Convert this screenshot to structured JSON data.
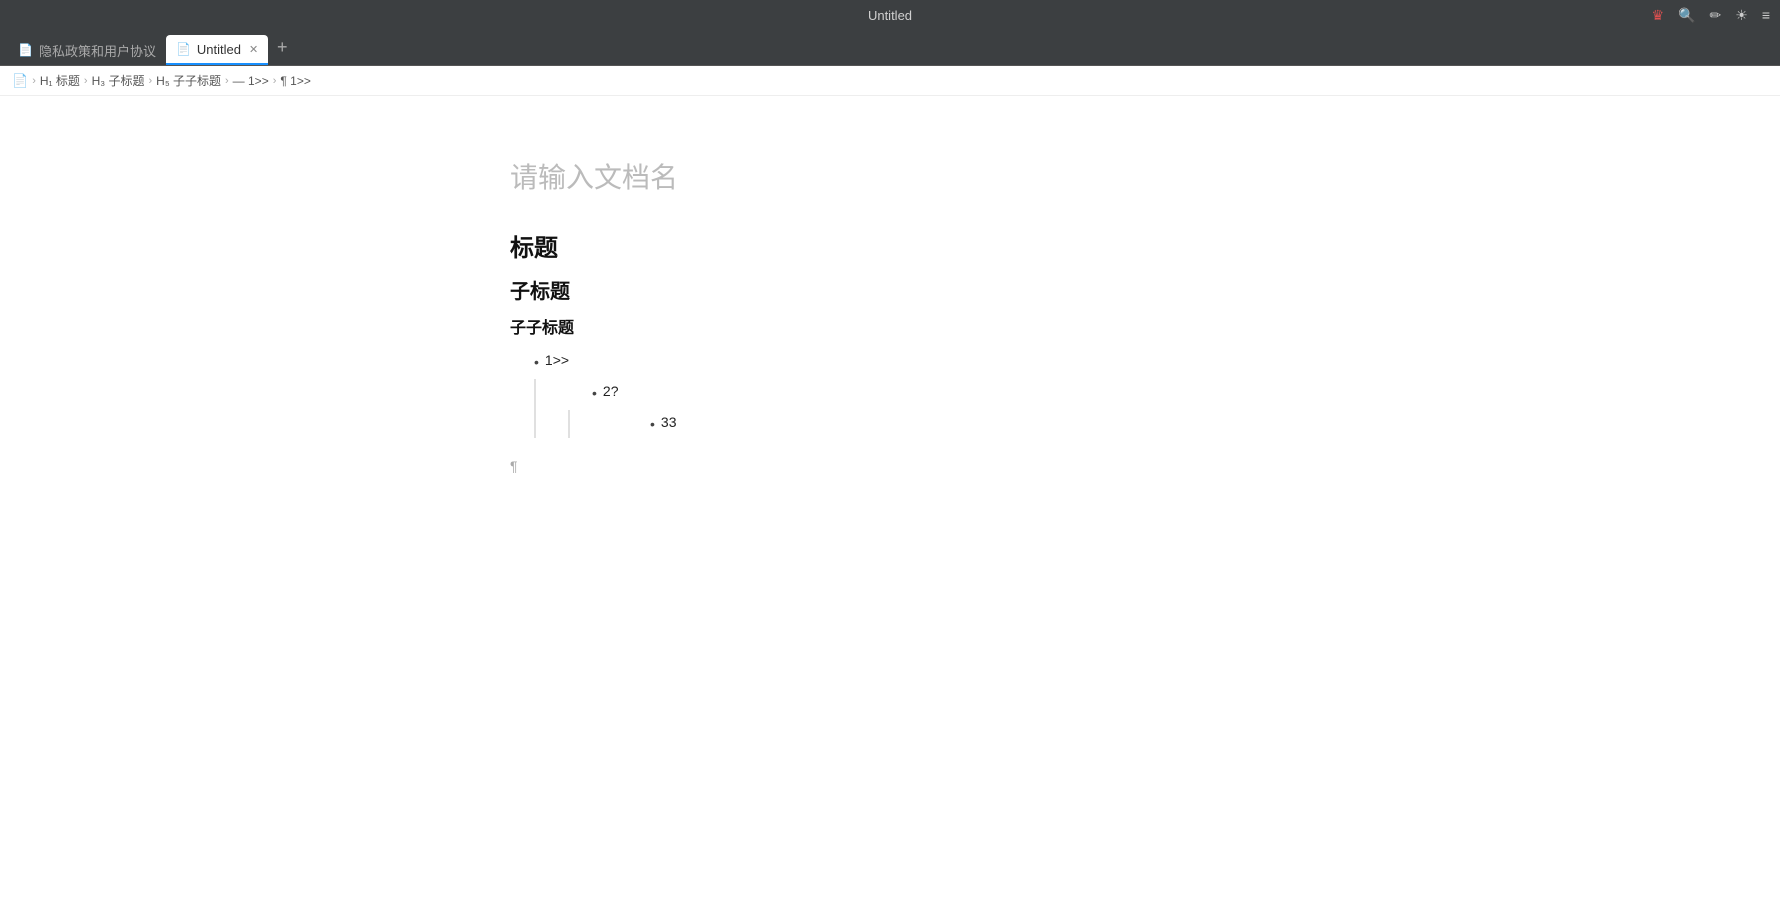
{
  "titlebar": {
    "title": "Untitled",
    "icons": {
      "crown": "♛",
      "search": "🔍",
      "edit": "✏",
      "sun": "☀",
      "menu": "≡"
    }
  },
  "tabs": [
    {
      "label": "隐私政策和用户协议",
      "active": false,
      "fileIcon": "📄"
    },
    {
      "label": "Untitled",
      "active": true,
      "fileIcon": "📄",
      "closable": true
    }
  ],
  "tab_add_label": "+",
  "breadcrumb": {
    "items": [
      {
        "type": "icon",
        "label": "📄"
      },
      {
        "type": "sep",
        "label": ">"
      },
      {
        "type": "text",
        "label": "H₁ 标题"
      },
      {
        "type": "sep",
        "label": ">"
      },
      {
        "type": "text",
        "label": "H₃ 子标题"
      },
      {
        "type": "sep",
        "label": ">"
      },
      {
        "type": "text",
        "label": "H₅ 子子标题"
      },
      {
        "type": "sep",
        "label": ">"
      },
      {
        "type": "text",
        "label": "— 1>>"
      },
      {
        "type": "sep",
        "label": ">"
      },
      {
        "type": "text",
        "label": "¶ 1>>"
      }
    ]
  },
  "editor": {
    "doc_title_placeholder": "请输入文档名",
    "h1": "标题",
    "h3": "子标题",
    "h5": "子子标题",
    "list_items": [
      {
        "level": 1,
        "text": "1>>"
      },
      {
        "level": 2,
        "text": "2?"
      },
      {
        "level": 3,
        "text": "33"
      }
    ],
    "paragraph_marker": "¶"
  }
}
